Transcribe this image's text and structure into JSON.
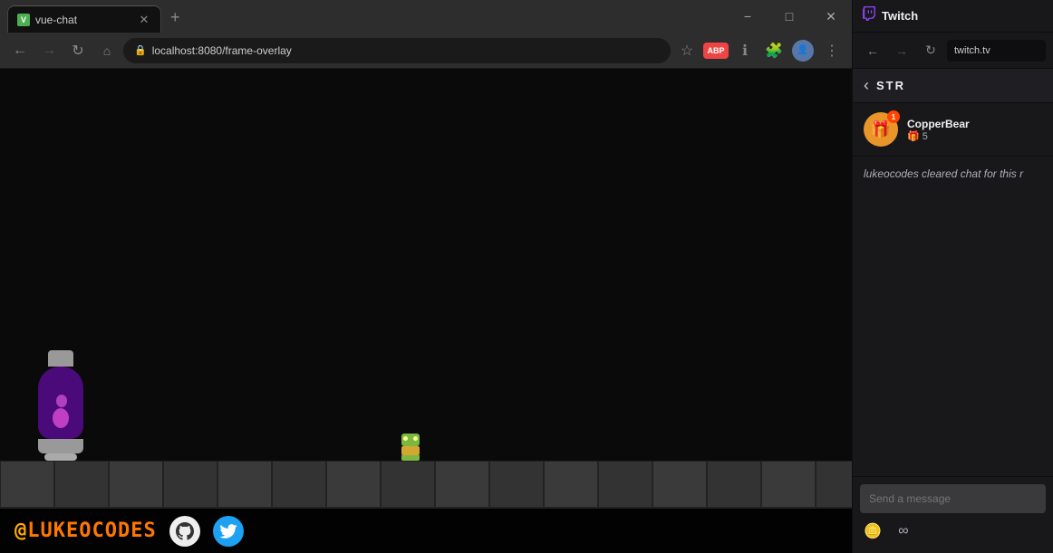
{
  "browser": {
    "tab_title": "vue-chat",
    "favicon": "V",
    "url": "localhost:8080/frame-overlay",
    "new_tab_tooltip": "New tab",
    "window_controls": {
      "minimize": "−",
      "maximize": "□",
      "close": "✕"
    },
    "nav": {
      "back": "←",
      "forward": "→",
      "reload": "↻",
      "home": "⌂"
    },
    "toolbar_icons": {
      "star": "☆",
      "abp": "ABP",
      "info": "ℹ",
      "extensions": "🧩",
      "menu": "⋮"
    }
  },
  "game": {
    "handle": "@LUKEOCODES",
    "handle_at": "@",
    "handle_text": "LUKEOCODES"
  },
  "twitch": {
    "title": "Twitch",
    "url": "twitch.tv",
    "stream_label": "STR",
    "gift_user": "CopperBear",
    "gift_icon": "🎁",
    "gift_badge_num": "1",
    "gift_sub_count": "🎁 5",
    "system_message": "lukeocodes cleared chat for this r",
    "chat_placeholder": "Send a message",
    "chat_action_coin": "🪙",
    "chat_action_infinity": "∞",
    "collapse_icon": "‹"
  }
}
